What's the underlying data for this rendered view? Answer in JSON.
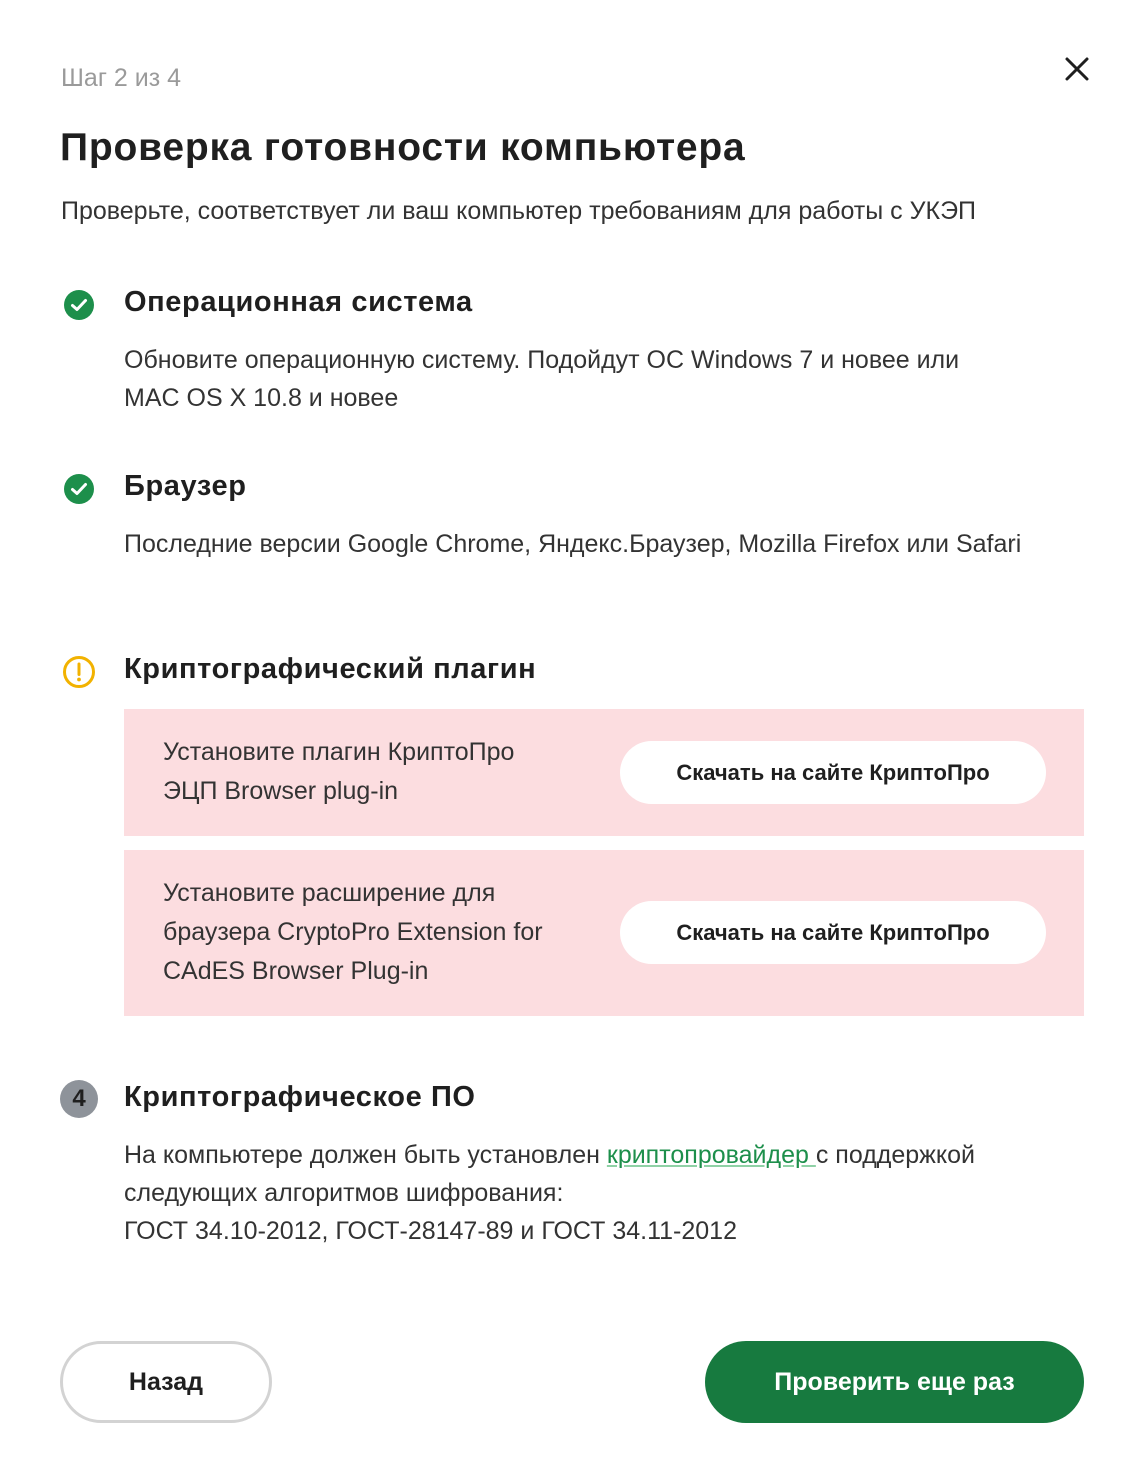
{
  "header": {
    "step_label": "Шаг 2 из 4",
    "title": "Проверка готовности компьютера",
    "subtitle": "Проверьте, соответствует ли ваш компьютер требованиям для работы с УКЭП"
  },
  "sections": {
    "os": {
      "status": "success",
      "icon": "check-circle-icon",
      "title": "Операционная система",
      "text": "Обновите операционную систему. Подойдут ОС Windows 7 и новее или MAC OS X 10.8 и новее"
    },
    "browser": {
      "status": "success",
      "icon": "check-circle-icon",
      "title": "Браузер",
      "text": "Последние версии Google Chrome, Яндекс.Браузер, Mozilla Firefox или Safari"
    },
    "plugin": {
      "status": "warning",
      "icon": "warning-circle-icon",
      "title": "Криптографический плагин",
      "items": [
        {
          "text": "Установите плагин КриптоПро ЭЦП Browser plug-in",
          "button": "Скачать на сайте КриптоПро"
        },
        {
          "text": "Установите расширение для браузера CryptoPro Extension for CAdES Browser Plug-in",
          "button": "Скачать на сайте КриптоПро"
        }
      ]
    },
    "crypto_software": {
      "status": "pending",
      "step_number": "4",
      "title": "Криптографическое ПО",
      "text_before": "На компьютере должен быть установлен ",
      "link": "криптопровайдер ",
      "text_after": "с поддержкой следующих алгоритмов шифрования:",
      "algorithms": "ГОСТ 34.10-2012, ГОСТ-28147-89 и ГОСТ 34.11-2012"
    }
  },
  "footer": {
    "back_label": "Назад",
    "recheck_label": "Проверить еще раз"
  },
  "colors": {
    "success": "#1d8f4b",
    "warning": "#f2b200",
    "primary_button": "#177a3f",
    "alert_background": "#fcdde0",
    "link": "#1d8f4b"
  }
}
